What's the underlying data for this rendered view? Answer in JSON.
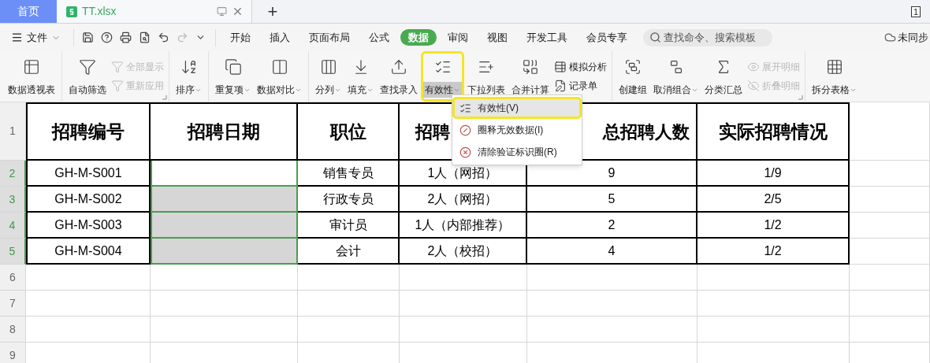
{
  "tabs": [
    {
      "label": "首页",
      "kind": "home",
      "selected": false
    },
    {
      "label": "TT.xlsx",
      "kind": "file",
      "selected": true
    }
  ],
  "new_tab": "+",
  "window_count": "1",
  "menu_bar": {
    "file_menu": "文件",
    "tabs": [
      {
        "label": "开始",
        "selected": false
      },
      {
        "label": "插入",
        "selected": false
      },
      {
        "label": "页面布局",
        "selected": false
      },
      {
        "label": "公式",
        "selected": false
      },
      {
        "label": "数据",
        "selected": true
      },
      {
        "label": "审阅",
        "selected": false
      },
      {
        "label": "视图",
        "selected": false
      },
      {
        "label": "开发工具",
        "selected": false
      },
      {
        "label": "会员专享",
        "selected": false
      }
    ],
    "search": {
      "placeholder": "查找命令、搜索模板"
    },
    "sync_status": "未同步"
  },
  "ribbon": {
    "groups": [
      {
        "items": [
          {
            "kind": "large",
            "label": "数据透视表"
          }
        ]
      },
      {
        "launcher": true,
        "items": [
          {
            "kind": "large",
            "label": "自动筛选"
          },
          {
            "kind": "stack",
            "items": [
              {
                "label": "全部显示",
                "disabled": true
              },
              {
                "label": "重新应用",
                "disabled": true
              }
            ]
          }
        ]
      },
      {
        "items": [
          {
            "kind": "large",
            "label": "排序",
            "caret": true
          }
        ]
      },
      {
        "items": [
          {
            "kind": "large",
            "label": "重复项",
            "caret": true
          },
          {
            "kind": "large",
            "label": "数据对比",
            "caret": true
          }
        ]
      },
      {
        "items": [
          {
            "kind": "large",
            "label": "分列",
            "caret": true
          },
          {
            "kind": "large",
            "label": "填充",
            "caret": true
          },
          {
            "kind": "large",
            "label": "查找录入"
          },
          {
            "kind": "large",
            "label": "有效性",
            "caret": true,
            "pressed": true
          },
          {
            "kind": "large",
            "label": "下拉列表"
          },
          {
            "kind": "large",
            "label": "合并计算"
          },
          {
            "kind": "stack",
            "items": [
              {
                "label": "模拟分析",
                "disabled": false
              },
              {
                "label": "记录单",
                "disabled": false
              }
            ]
          }
        ]
      },
      {
        "launcher": true,
        "items": [
          {
            "kind": "large",
            "label": "创建组"
          },
          {
            "kind": "large",
            "label": "取消组合",
            "caret": true
          },
          {
            "kind": "large",
            "label": "分类汇总"
          },
          {
            "kind": "stack",
            "items": [
              {
                "label": "展开明细",
                "disabled": true
              },
              {
                "label": "折叠明细",
                "disabled": true
              }
            ]
          }
        ]
      },
      {
        "items": [
          {
            "kind": "large",
            "label": "拆分表格",
            "caret": true
          }
        ]
      }
    ]
  },
  "dropdown_menu": {
    "items": [
      {
        "label": "有效性(V)",
        "selected": true
      },
      {
        "label": "圈释无效数据(I)",
        "selected": false
      },
      {
        "label": "清除验证标识圈(R)",
        "selected": false
      }
    ]
  },
  "sheet": {
    "header_row": {
      "number": "1",
      "columns": [
        "招聘编号",
        "招聘日期",
        "职位",
        "招聘",
        "总招聘人数",
        "实际招聘情况"
      ]
    },
    "rows": [
      {
        "number": "2",
        "selected": true,
        "active": true,
        "code": "GH-M-S001",
        "position": "销售专员",
        "hires": "1人（网招）",
        "total": "9",
        "actual": "1/9"
      },
      {
        "number": "3",
        "selected": true,
        "active": false,
        "code": "GH-M-S002",
        "position": "行政专员",
        "hires": "2人（网招）",
        "total": "5",
        "actual": "2/5"
      },
      {
        "number": "4",
        "selected": true,
        "active": false,
        "code": "GH-M-S003",
        "position": "审计员",
        "hires": "1人（内部推荐）",
        "total": "2",
        "actual": "1/2"
      },
      {
        "number": "5",
        "selected": true,
        "active": false,
        "code": "GH-M-S004",
        "position": "会计",
        "hires": "2人（校招）",
        "total": "4",
        "actual": "1/2"
      }
    ],
    "empty_rows": [
      "6",
      "7",
      "8",
      "9"
    ]
  }
}
